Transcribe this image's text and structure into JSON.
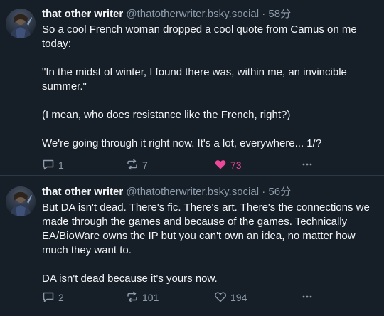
{
  "posts": [
    {
      "author": {
        "display_name": "that other writer",
        "handle": "@thatotherwriter.bsky.social",
        "avatar_icon": "avatar-dark-figure"
      },
      "separator": "·",
      "time": "58分",
      "body": "So a cool French woman dropped a cool quote from Camus on me today:\n\n\"In the midst of winter, I found there was, within me, an invincible summer.\"\n\n(I mean, who does resistance like the French, right?)\n\nWe're going through it right now. It's a lot, everywhere... 1/?",
      "replies": "1",
      "reposts": "7",
      "likes": "73",
      "liked": true
    },
    {
      "author": {
        "display_name": "that other writer",
        "handle": "@thatotherwriter.bsky.social",
        "avatar_icon": "avatar-dark-figure"
      },
      "separator": "·",
      "time": "56分",
      "body": "But DA isn't dead. There's fic. There's art. There's the connections we made through the games and because of the games. Technically EA/BioWare owns the IP but you can't own an idea, no matter how much they want to.\n\nDA isn't dead because it's  yours now.",
      "replies": "2",
      "reposts": "101",
      "likes": "194",
      "liked": false
    }
  ],
  "colors": {
    "background": "#161e27",
    "text": "#f1f3f5",
    "muted": "#8c9bab",
    "like_active": "#ec4899"
  },
  "icons": {
    "reply": "reply-bubble-icon",
    "repost": "repost-arrows-icon",
    "like": "heart-icon",
    "more": "more-dots-icon"
  }
}
